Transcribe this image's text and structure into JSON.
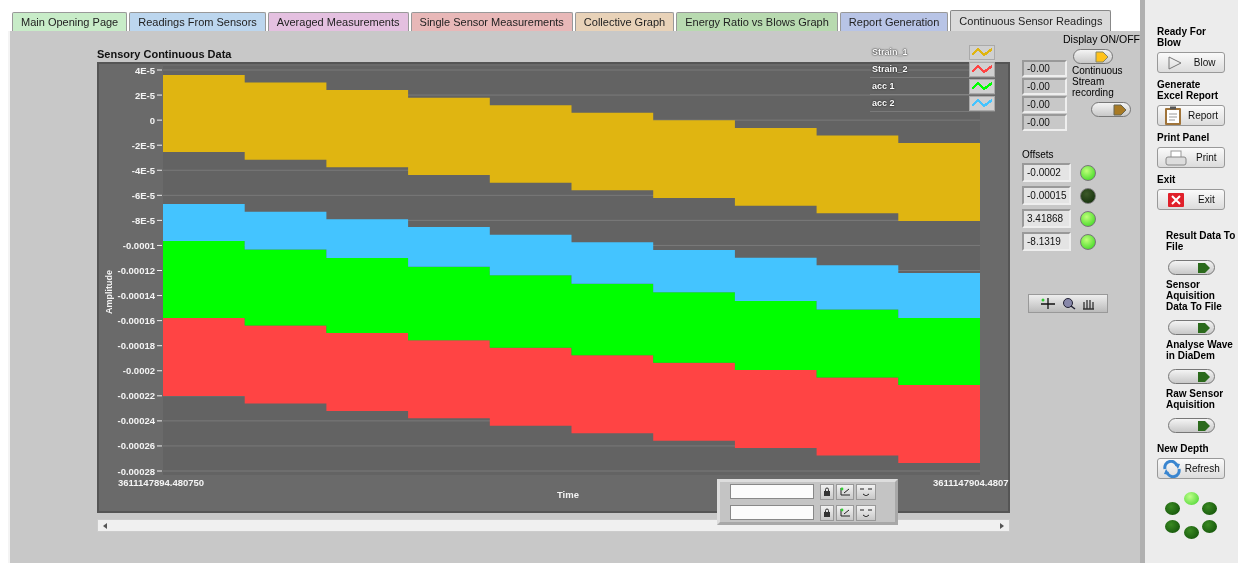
{
  "tabs": [
    {
      "label": "Main Opening Page",
      "selected": false,
      "color": "#c8ecc8"
    },
    {
      "label": "Readings From Sensors",
      "selected": false,
      "color": "#bcd6ee"
    },
    {
      "label": "Averaged Measurements",
      "selected": false,
      "color": "#e4c0e0"
    },
    {
      "label": "Single Sensor Measurements",
      "selected": false,
      "color": "#e8b8b8"
    },
    {
      "label": "Collective Graph",
      "selected": false,
      "color": "#e8d2b8"
    },
    {
      "label": "Energy Ratio vs Blows Graph",
      "selected": false,
      "color": "#b8dab0"
    },
    {
      "label": "Report Generation",
      "selected": false,
      "color": "#b8c4e6"
    },
    {
      "label": "Continuous Sensor Readings",
      "selected": true,
      "color": "#dadada"
    }
  ],
  "graph": {
    "title": "Sensory Continuous Data",
    "xlabel": "Time",
    "ylabel": "Amplitude",
    "y_ticks": [
      "4E-5",
      "2E-5",
      "0",
      "-2E-5",
      "-4E-5",
      "-6E-5",
      "-8E-5",
      "-0.0001",
      "-0.00012",
      "-0.00014",
      "-0.00016",
      "-0.00018",
      "-0.0002",
      "-0.00022",
      "-0.00024",
      "-0.00026",
      "-0.00028"
    ],
    "x_ticks": [
      "3611147894.480750",
      "3611147904.4807"
    ],
    "legend": [
      {
        "name": "Strain_1",
        "color": "#e0b511"
      },
      {
        "name": "Strain_2",
        "color": "#ff4444"
      },
      {
        "name": "acc 1",
        "color": "#00ff00"
      },
      {
        "name": "acc 2",
        "color": "#44c4ff"
      }
    ]
  },
  "display_toggle": {
    "label": "Display ON/OFF",
    "on": true
  },
  "readouts": [
    "-0.00",
    "-0.00",
    "-0.00",
    "-0.00"
  ],
  "stream_toggle": {
    "label": "Continuous Stream recording",
    "on": false
  },
  "offsets": {
    "label": "Offsets",
    "rows": [
      {
        "value": "-0.0002",
        "led": true
      },
      {
        "value": "-0.00015",
        "led": false
      },
      {
        "value": "3.41868",
        "led": true
      },
      {
        "value": "-8.1319",
        "led": true
      }
    ]
  },
  "side_panel": [
    {
      "kind": "button",
      "label": "Ready For Blow",
      "caption": "Blow"
    },
    {
      "kind": "button",
      "label": "Generate Excel Report",
      "caption": "Report"
    },
    {
      "kind": "button",
      "label": "Print Panel",
      "caption": "Print"
    },
    {
      "kind": "button",
      "label": "Exit",
      "caption": "Exit"
    },
    {
      "kind": "toggle",
      "label": "Result Data To File",
      "on": false
    },
    {
      "kind": "toggle",
      "label": "Sensor Aquisition Data To File",
      "on": false
    },
    {
      "kind": "toggle",
      "label": "Analyse Wave in DiaDem",
      "on": false
    },
    {
      "kind": "toggle",
      "label": "Raw Sensor Aquisition",
      "on": false
    },
    {
      "kind": "button",
      "label": "New Depth",
      "caption": "Refresh"
    }
  ],
  "busy_ring": [
    {
      "on": true
    },
    {
      "on": false
    },
    {
      "on": false
    },
    {
      "on": false
    },
    {
      "on": false
    },
    {
      "on": false
    }
  ]
}
